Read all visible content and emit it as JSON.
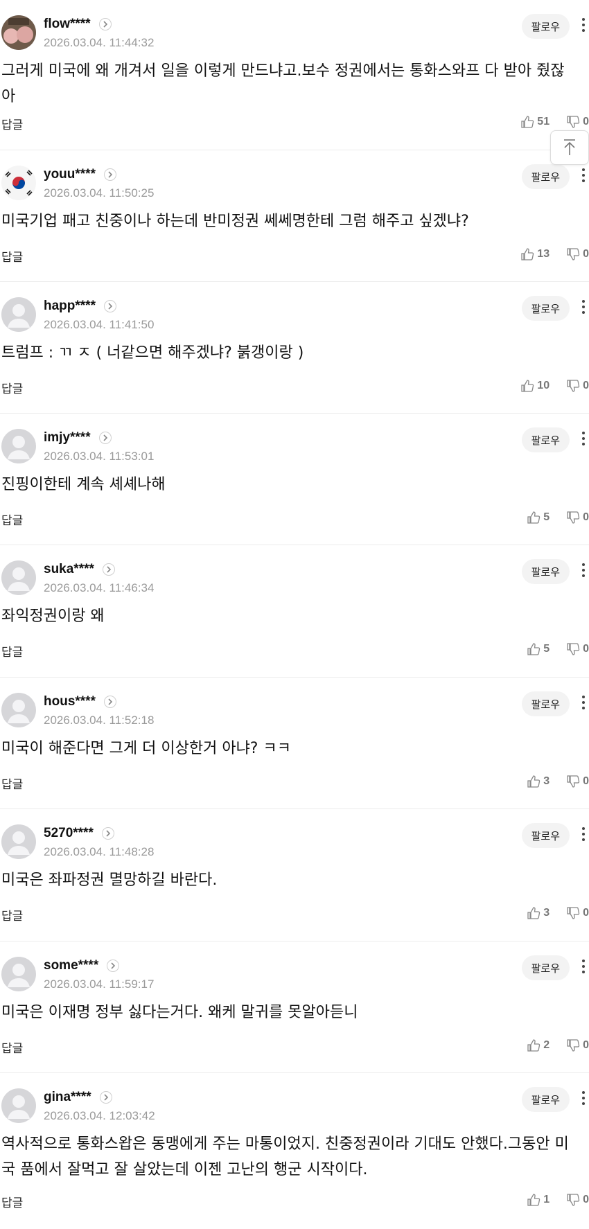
{
  "labels": {
    "follow": "팔로우",
    "reply": "답글"
  },
  "comments": [
    {
      "author": "flow****",
      "date": "2026.03.04. 11:44:32",
      "text": "그러게 미국에 왜 개겨서 일을 이렇게 만드냐고.보수 정권에서는 통화스와프 다 받아 줬잖아",
      "likes": "51",
      "dislikes": "0",
      "avatar": "photo"
    },
    {
      "author": "youu****",
      "date": "2026.03.04. 11:50:25",
      "text": "미국기업 패고 친중이나 하는데 반미정권 쎄쎄명한테 그럼 해주고 싶겠냐?",
      "likes": "13",
      "dislikes": "0",
      "avatar": "flag"
    },
    {
      "author": "happ****",
      "date": "2026.03.04. 11:41:50",
      "text": "트럼프 : ㄲ ㅈ ( 너같으면 해주겠냐? 붉갱이랑 )",
      "likes": "10",
      "dislikes": "0",
      "avatar": "default"
    },
    {
      "author": "imjy****",
      "date": "2026.03.04. 11:53:01",
      "text": "진핑이한테 계속 셰셰나해",
      "likes": "5",
      "dislikes": "0",
      "avatar": "default"
    },
    {
      "author": "suka****",
      "date": "2026.03.04. 11:46:34",
      "text": "좌익정권이랑 왜",
      "likes": "5",
      "dislikes": "0",
      "avatar": "default"
    },
    {
      "author": "hous****",
      "date": "2026.03.04. 11:52:18",
      "text": "미국이 해준다면 그게 더 이상한거 아냐? ㅋㅋ",
      "likes": "3",
      "dislikes": "0",
      "avatar": "default"
    },
    {
      "author": "5270****",
      "date": "2026.03.04. 11:48:28",
      "text": "미국은 좌파정권 멸망하길 바란다.",
      "likes": "3",
      "dislikes": "0",
      "avatar": "default"
    },
    {
      "author": "some****",
      "date": "2026.03.04. 11:59:17",
      "text": "미국은 이재명 정부 싫다는거다. 왜케 말귀를 못알아듣니",
      "likes": "2",
      "dislikes": "0",
      "avatar": "default"
    },
    {
      "author": "gina****",
      "date": "2026.03.04. 12:03:42",
      "text": "역사적으로 통화스왑은 동맹에게 주는 마통이었지. 친중정권이라 기대도 안했다.그동안 미국 품에서 잘먹고 잘 살았는데 이젠 고난의 행군 시작이다.",
      "likes": "1",
      "dislikes": "0",
      "avatar": "default"
    }
  ]
}
